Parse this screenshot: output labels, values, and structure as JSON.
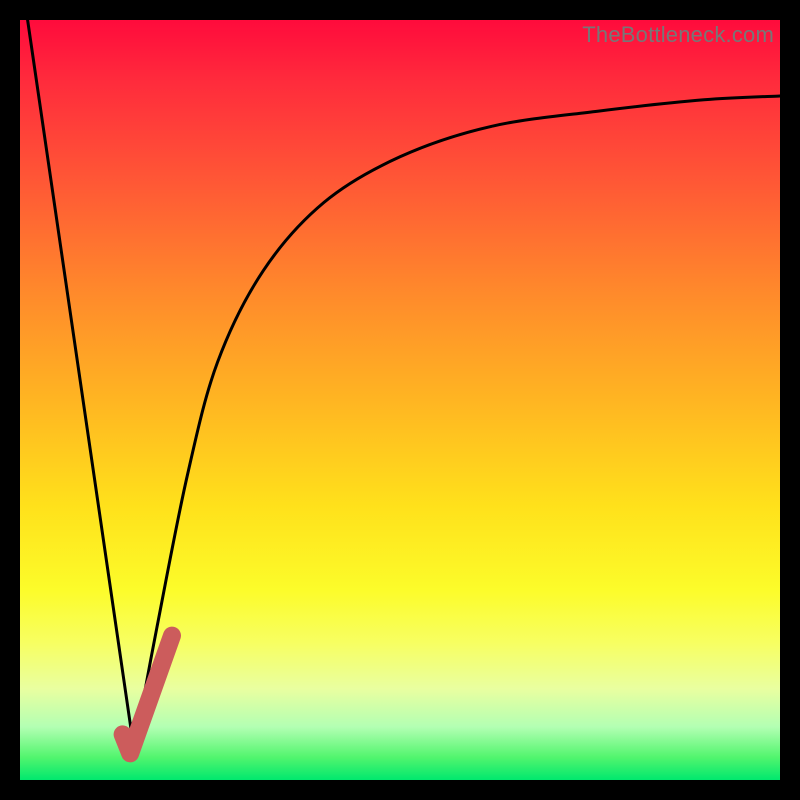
{
  "watermark": "TheBottleneck.com",
  "chart_data": {
    "type": "line",
    "title": "",
    "xlabel": "",
    "ylabel": "",
    "xlim": [
      0,
      100
    ],
    "ylim": [
      0,
      100
    ],
    "grid": false,
    "legend": false,
    "series": [
      {
        "name": "left-descending-segment",
        "x": [
          1,
          15
        ],
        "y": [
          100,
          4
        ]
      },
      {
        "name": "right-ascending-curve",
        "x": [
          15,
          18,
          22,
          26,
          32,
          40,
          50,
          62,
          76,
          90,
          100
        ],
        "y": [
          4,
          20,
          40,
          55,
          67,
          76,
          82,
          86,
          88,
          89.5,
          90
        ]
      }
    ],
    "annotations": [
      {
        "name": "pink-hook",
        "type": "path",
        "color": "#cc5c5c",
        "points_x": [
          13.5,
          14.5,
          20
        ],
        "points_y": [
          6,
          3.5,
          19
        ]
      }
    ],
    "background_gradient": {
      "orientation": "vertical",
      "stops": [
        {
          "pos": 0.0,
          "color": "#ff0b3c"
        },
        {
          "pos": 0.5,
          "color": "#ffb522"
        },
        {
          "pos": 0.75,
          "color": "#fcfc2a"
        },
        {
          "pos": 1.0,
          "color": "#00e86e"
        }
      ]
    }
  }
}
